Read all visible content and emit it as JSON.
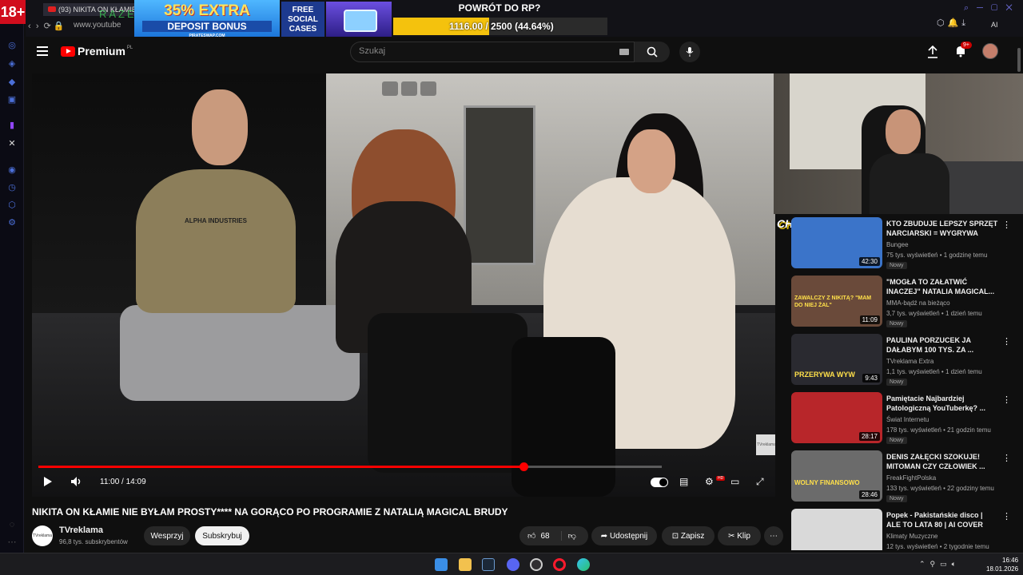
{
  "browser": {
    "rail_badge": "18+",
    "tab_title": "(93) NIKITA ON KŁAMIE N",
    "address": "www.youtube",
    "ai_label": "AI",
    "razer_text": "RAZER"
  },
  "ads": {
    "banner_line1": "35% EXTRA",
    "banner_line2": "DEPOSIT BONUS",
    "banner_line3": "PIRATESWAP.COM",
    "free_cases": "FREE SOCIAL CASES"
  },
  "rp_goal": {
    "title": "POWRÓT DO RP?",
    "progress_text": "1116.00 / 2500 (44.64%)",
    "progress_fraction": 0.4464,
    "bar_color": "#f4c20d"
  },
  "header": {
    "logo_text": "Premium",
    "logo_region": "PL",
    "search_placeholder": "Szukaj",
    "notif_count": "9+"
  },
  "player": {
    "time": "11:00 / 14:09",
    "progress_fraction": 0.778,
    "brand_mark": "TVreklama",
    "shirt_text": "ALPHA INDUSTRIES"
  },
  "video": {
    "title": "NIKITA ON KŁAMIE NIE BYŁAM PROSTY**** NA GORĄCO PO PROGRAMIE Z NATALIĄ MAGICAL BRUDY",
    "channel": "TVreklama",
    "subscribers": "96,8 tys. subskrybentów",
    "join_label": "Wesprzyj",
    "subscribe_label": "Subskrybuj",
    "likes": "68",
    "share_label": "Udostępnij",
    "save_label": "Zapisz",
    "clip_label": "Klip"
  },
  "overlay": {
    "chat_label": "CHAT"
  },
  "recommendations": [
    {
      "title": "KTO ZBUDUJE LEPSZY SPRZĘT NARCIARSKI = WYGRYWA",
      "channel": "Bungee",
      "meta": "75 tys. wyświetleń • 1 godzinę temu",
      "badge": "Nowy",
      "duration": "42:30",
      "thumb_color": "#3b74c9"
    },
    {
      "title": "\"MOGŁA TO ZAŁATWIĆ INACZEJ\" NATALIA MAGICAL...",
      "channel": "MMA-bądź na bieżąco",
      "meta": "3,7 tys. wyświetleń • 1 dzień temu",
      "badge": "Nowy",
      "duration": "11:09",
      "thumb_color": "#6a4a3a",
      "thumb_text": "ZAWALCZY Z NIKITĄ? \"MAM DO NIEJ ŻAL\""
    },
    {
      "title": "PAULINA PORZUCEK JA DAŁABYM 100 TYS. ZA ...",
      "channel": "TVreklama Extra",
      "meta": "1,1 tys. wyświetleń • 1 dzień temu",
      "badge": "Nowy",
      "duration": "9:43",
      "thumb_color": "#2a2a30",
      "thumb_text": "PRZERYWA WYW"
    },
    {
      "title": "Pamiętacie Najbardziej Patologiczną YouTuberkę? ...",
      "channel": "Świat Internetu",
      "meta": "178 tys. wyświetleń • 21 godzin temu",
      "badge": "Nowy",
      "duration": "28:17",
      "thumb_color": "#b8262a"
    },
    {
      "title": "DENIS ZAŁĘCKI SZOKUJE! MITOMAN CZY CZŁOWIEK ...",
      "channel": "FreakFightPolska",
      "meta": "133 tys. wyświetleń • 22 godziny temu",
      "badge": "Nowy",
      "duration": "28:46",
      "thumb_color": "#6b6b6b",
      "thumb_text": "WOLNY FINANSOWO"
    },
    {
      "title": "Popek - Pakistańskie disco | ALE TO LATA 80 | AI COVER",
      "channel": "Klimaty Muzyczne",
      "meta": "12 tys. wyświetleń • 2 tygodnie temu",
      "badge": "",
      "duration": "",
      "thumb_color": "#d9d9d9"
    }
  ],
  "taskbar": {
    "time": "16:46",
    "date": "18.01.2026",
    "icons": [
      "windows-start",
      "file-explorer",
      "steam",
      "discord",
      "obs",
      "opera",
      "edge"
    ]
  }
}
